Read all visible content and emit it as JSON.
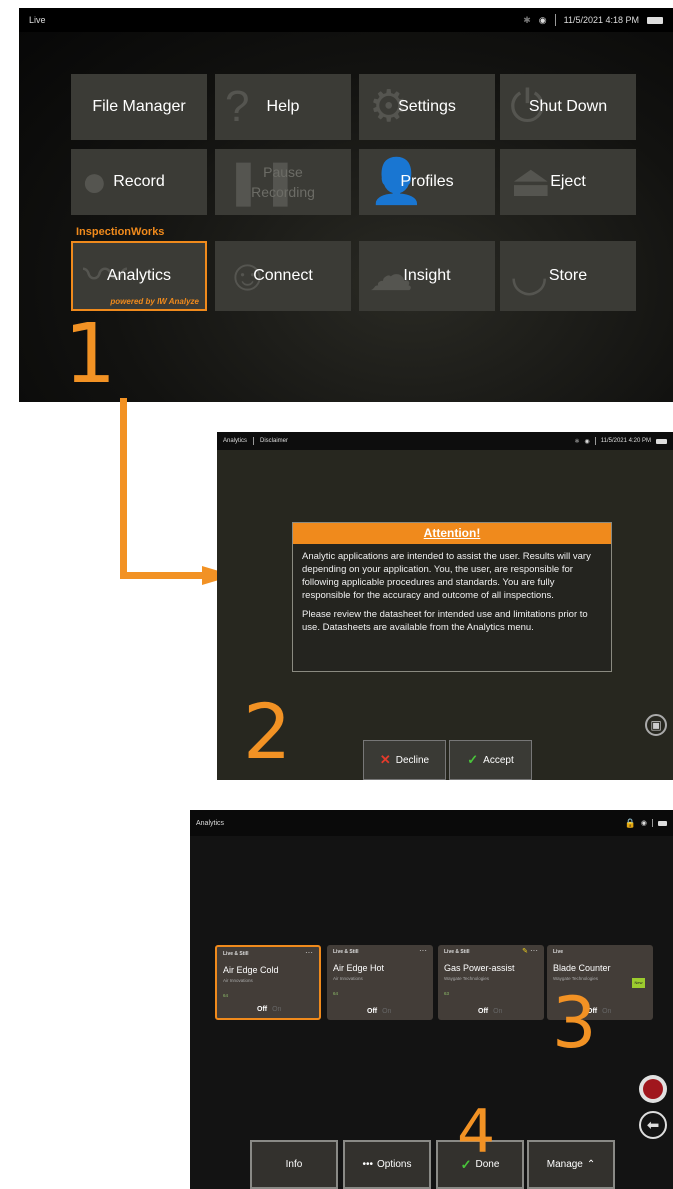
{
  "panel1": {
    "status_left": "Live",
    "datetime": "11/5/2021  4:18 PM",
    "section_label": "InspectionWorks",
    "tiles": {
      "file_manager": "File Manager",
      "help": "Help",
      "settings": "Settings",
      "shut_down": "Shut Down",
      "record": "Record",
      "pause_recording_line1": "Pause",
      "pause_recording_line2": "Recording",
      "profiles": "Profiles",
      "eject": "Eject",
      "analytics": "Analytics",
      "analytics_subtitle": "powered by IW Analyze",
      "connect": "Connect",
      "insight": "Insight",
      "store": "Store"
    },
    "step_number": "1"
  },
  "panel2": {
    "breadcrumb_1": "Analytics",
    "breadcrumb_2": "Disclaimer",
    "datetime": "11/5/2021  4:20 PM",
    "dialog": {
      "title": "Attention!",
      "para1": "Analytic applications are intended to assist the user. Results will vary depending on your application. You, the user, are responsible for following applicable procedures and standards. You are fully responsible for the accuracy and outcome of all inspections.",
      "para2": "Please review the datasheet for intended use and limitations prior to use. Datasheets are available from the Analytics menu."
    },
    "decline_label": "Decline",
    "accept_label": "Accept",
    "step_number": "2"
  },
  "panel3": {
    "title": "Analytics",
    "cards": [
      {
        "mode": "Live & Still",
        "name": "Air Edge Cold",
        "vendor": "Air Innovations",
        "version": "64",
        "off": "Off",
        "on": "On"
      },
      {
        "mode": "Live & Still",
        "name": "Air Edge Hot",
        "vendor": "Air Innovations",
        "version": "64",
        "off": "Off",
        "on": "On"
      },
      {
        "mode": "Live & Still",
        "name": "Gas Power-assist",
        "vendor": "Waygate Technologies",
        "version": "63",
        "off": "Off",
        "on": "On"
      },
      {
        "mode": "Live",
        "name": "Blade Counter",
        "vendor": "Waygate Technologies",
        "version": "",
        "off": "Off",
        "on": "On",
        "badge": "New"
      }
    ],
    "buttons": {
      "info": "Info",
      "options": "Options",
      "done": "Done",
      "manage": "Manage"
    },
    "step_number_3": "3",
    "step_number_4": "4"
  },
  "colors": {
    "accent": "#f08a1c",
    "step_number": "#f29224",
    "record": "#a0161d",
    "accept_check": "#49c43a",
    "decline_x": "#e53a2b"
  }
}
